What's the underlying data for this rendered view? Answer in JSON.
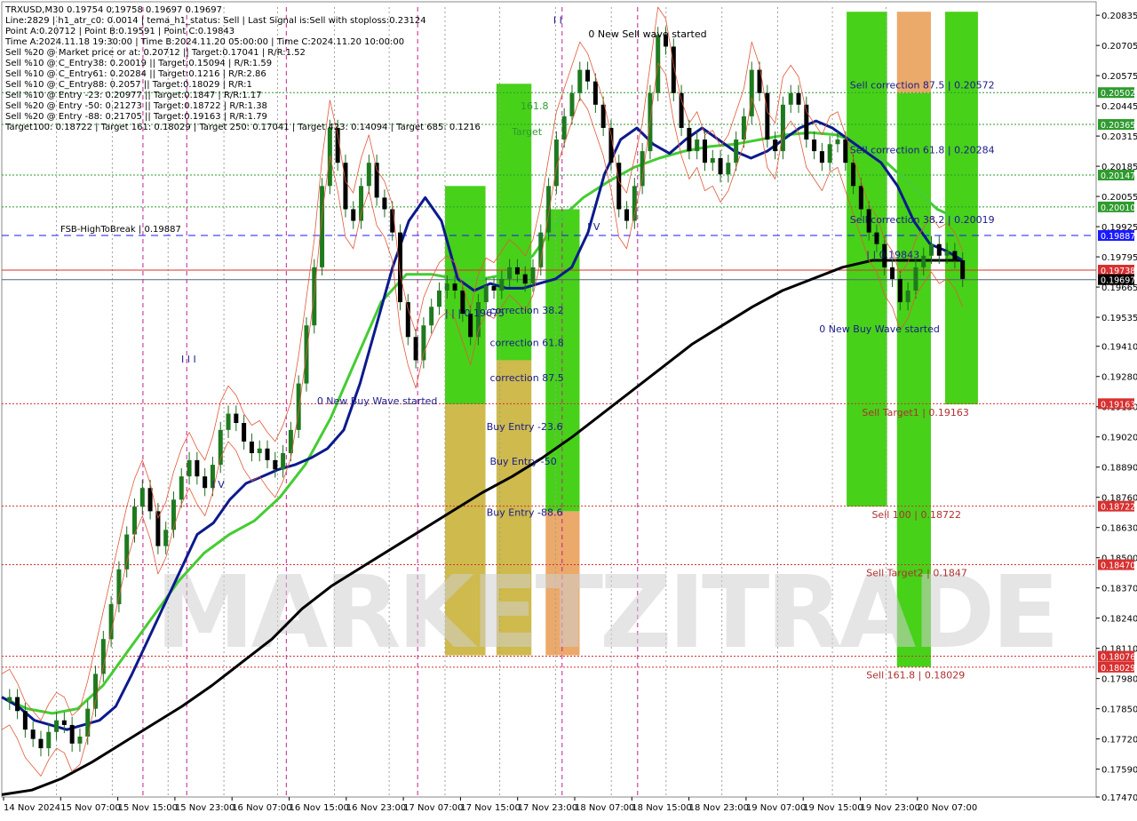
{
  "header": {
    "symbol_line": "TRXUSD,M30  0.19754 0.19758 0.19697 0.19697",
    "lines": [
      "Line:2829  |  h1_atr_c0: 0.0014  |  tema_h1_status: Sell  |  Last Signal is:Sell with stoploss:0.23124",
      "Point A:0.20712  |  Point B:0.19591  |  Point C:0.19843",
      "Time A:2024.11.18 19:30:00  |  Time B:2024.11.20 05:00:00  |  Time C:2024.11.20 10:00:00",
      "Sell %20 @ Market price or at: 0.20712  ||  Target:0.17041  |  R/R:1.52",
      "Sell %10 @ C_Entry38: 0.20019  ||  Target:0.15094  |  R/R:1.59",
      "Sell %10 @ C_Entry61: 0.20284  ||  Target:0.1216  |  R/R:2.86",
      "Sell %10 @ C_Entry88: 0.2057  ||  Target:0.18029  |  R/R:1",
      "Sell %10 @ Entry -23: 0.20977  ||  Target:0.1847  |  R/R:1.17",
      "Sell %20 @ Entry -50: 0.21273  ||  Target:0.18722  |  R/R:1.38",
      "Sell %20 @ Entry -88: 0.21705  ||  Target:0.19163  |  R/R:1.79",
      "Target100: 0.18722  |  Target 161: 0.18029  |  Target 250: 0.17041  |  Target 423: 0.14094  |  Target 685: 0.1216"
    ]
  },
  "watermark": "MARKETZITRADE",
  "colors": {
    "price_tag_green": "#2e9b2e",
    "price_tag_red": "#d83030",
    "price_tag_blue": "#1a1aff",
    "price_tag_black": "#000000",
    "zone_green": "#33cc00",
    "zone_orange": "#e9a05a",
    "zone_olive": "#c9b23a",
    "ma_blue": "#0b1a8c",
    "ma_green": "#44cc33",
    "ma_black": "#000000"
  },
  "chart_data": {
    "type": "line",
    "title": "TRXUSD,M30",
    "ylim": [
      0.1747,
      0.2087
    ],
    "y_ticks": [
      "0.20835",
      "0.20705",
      "0.20575",
      "0.20445",
      "0.20315",
      "0.20185",
      "0.20055",
      "0.19925",
      "0.19795",
      "0.19665",
      "0.19535",
      "0.19410",
      "0.19280",
      "0.19150",
      "0.19020",
      "0.18890",
      "0.18760",
      "0.18630",
      "0.18500",
      "0.18370",
      "0.18240",
      "0.18110",
      "0.17980",
      "0.17850",
      "0.17720",
      "0.17590",
      "0.17470"
    ],
    "x_ticks": [
      "14 Nov 2024",
      "15 Nov 07:00",
      "15 Nov 15:00",
      "15 Nov 23:00",
      "16 Nov 07:00",
      "16 Nov 15:00",
      "16 Nov 23:00",
      "17 Nov 07:00",
      "17 Nov 15:00",
      "17 Nov 23:00",
      "18 Nov 07:00",
      "18 Nov 15:00",
      "18 Nov 23:00",
      "19 Nov 07:00",
      "19 Nov 15:00",
      "19 Nov 23:00",
      "20 Nov 07:00"
    ],
    "close_path": [
      0.1788,
      0.179,
      0.1784,
      0.1776,
      0.1772,
      0.1768,
      0.1775,
      0.178,
      0.1778,
      0.177,
      0.1773,
      0.1785,
      0.18,
      0.1815,
      0.183,
      0.1845,
      0.186,
      0.1872,
      0.188,
      0.187,
      0.1855,
      0.1862,
      0.1875,
      0.1885,
      0.1892,
      0.1885,
      0.188,
      0.189,
      0.1905,
      0.1912,
      0.1908,
      0.19,
      0.1895,
      0.1897,
      0.1892,
      0.1888,
      0.1895,
      0.1905,
      0.1925,
      0.195,
      0.1975,
      0.201,
      0.2035,
      0.202,
      0.2,
      0.1995,
      0.201,
      0.202,
      0.2005,
      0.2,
      0.199,
      0.196,
      0.1945,
      0.1935,
      0.195,
      0.1958,
      0.1965,
      0.1968,
      0.1965,
      0.1955,
      0.1945,
      0.196,
      0.1967,
      0.1965,
      0.197,
      0.1975,
      0.1972,
      0.1968,
      0.1975,
      0.199,
      0.201,
      0.203,
      0.204,
      0.205,
      0.206,
      0.2055,
      0.2045,
      0.2035,
      0.202,
      0.2,
      0.1995,
      0.201,
      0.2025,
      0.205,
      0.2075,
      0.207,
      0.205,
      0.2035,
      0.2025,
      0.203,
      0.202,
      0.2022,
      0.2015,
      0.202,
      0.203,
      0.204,
      0.206,
      0.205,
      0.203,
      0.2025,
      0.2045,
      0.205,
      0.2045,
      0.203,
      0.2025,
      0.202,
      0.2028,
      0.203,
      0.202,
      0.201,
      0.2,
      0.199,
      0.1985,
      0.1975,
      0.197,
      0.196,
      0.1965,
      0.1975,
      0.198,
      0.1985,
      0.198,
      0.1982,
      0.1978,
      0.197
    ],
    "ma_blue_path": [
      0.179,
      0.1786,
      0.178,
      0.1778,
      0.1776,
      0.1778,
      0.178,
      0.1786,
      0.18,
      0.1815,
      0.183,
      0.1845,
      0.186,
      0.1865,
      0.1875,
      0.1882,
      0.1885,
      0.1888,
      0.189,
      0.1893,
      0.1897,
      0.1905,
      0.1925,
      0.195,
      0.1975,
      0.1995,
      0.2005,
      0.1995,
      0.197,
      0.1965,
      0.1968,
      0.1966,
      0.1966,
      0.1968,
      0.197,
      0.1975,
      0.199,
      0.2015,
      0.203,
      0.2035,
      0.2028,
      0.2024,
      0.203,
      0.2035,
      0.203,
      0.2025,
      0.2022,
      0.2025,
      0.203,
      0.2035,
      0.2038,
      0.2035,
      0.203,
      0.2025,
      0.202,
      0.201,
      0.1995,
      0.1985,
      0.1982,
      0.1978
    ],
    "ma_green_path": [
      0.179,
      0.1785,
      0.1783,
      0.1785,
      0.1795,
      0.181,
      0.1825,
      0.184,
      0.1852,
      0.186,
      0.1866,
      0.1876,
      0.189,
      0.191,
      0.1935,
      0.196,
      0.1972,
      0.1972,
      0.197,
      0.197,
      0.1972,
      0.198,
      0.1995,
      0.2005,
      0.2012,
      0.2018,
      0.2022,
      0.2025,
      0.2027,
      0.2028,
      0.203,
      0.2032,
      0.2033,
      0.2032,
      0.2028,
      0.202,
      0.201,
      0.2,
      0.1995
    ],
    "ma_black_path": [
      0.1748,
      0.175,
      0.1755,
      0.1762,
      0.177,
      0.1778,
      0.1786,
      0.1795,
      0.1805,
      0.1815,
      0.1828,
      0.1838,
      0.1846,
      0.1854,
      0.1862,
      0.187,
      0.1878,
      0.1885,
      0.1893,
      0.1902,
      0.1912,
      0.1922,
      0.1932,
      0.1942,
      0.195,
      0.1958,
      0.1965,
      0.197,
      0.1975,
      0.1978,
      0.1978,
      0.1978,
      0.1978
    ],
    "h_lines": [
      {
        "label": "FSB-HighToBreak | 0.19887",
        "value": 0.19887,
        "color": "#1a1aff",
        "style": "dash"
      },
      {
        "label": "",
        "value": 0.19738,
        "color": "#d83030",
        "style": "solid"
      },
      {
        "label": "",
        "value": 0.19697,
        "color": "#556677",
        "style": "solid"
      },
      {
        "label": "",
        "value": 0.20502,
        "color": "#2e9b2e",
        "style": "dot"
      },
      {
        "label": "",
        "value": 0.20365,
        "color": "#2e9b2e",
        "style": "dot"
      },
      {
        "label": "",
        "value": 0.20147,
        "color": "#2e9b2e",
        "style": "dot"
      },
      {
        "label": "",
        "value": 0.2001,
        "color": "#2e9b2e",
        "style": "dot"
      },
      {
        "label": "",
        "value": 0.19163,
        "color": "#d83030",
        "style": "dot"
      },
      {
        "label": "",
        "value": 0.18722,
        "color": "#d83030",
        "style": "dot"
      },
      {
        "label": "",
        "value": 0.1847,
        "color": "#d83030",
        "style": "dot"
      },
      {
        "label": "",
        "value": 0.18076,
        "color": "#d83030",
        "style": "dot"
      },
      {
        "label": "",
        "value": 0.18029,
        "color": "#d83030",
        "style": "dot"
      }
    ],
    "price_tags": [
      {
        "text": "0.20502",
        "value": 0.20502,
        "kind": "green"
      },
      {
        "text": "0.20365",
        "value": 0.20365,
        "kind": "green"
      },
      {
        "text": "0.20147",
        "value": 0.20147,
        "kind": "green"
      },
      {
        "text": "0.20010",
        "value": 0.2001,
        "kind": "green"
      },
      {
        "text": "0.19887",
        "value": 0.19887,
        "kind": "blue"
      },
      {
        "text": "0.19738",
        "value": 0.19738,
        "kind": "red"
      },
      {
        "text": "0.19697",
        "value": 0.19697,
        "kind": "black"
      },
      {
        "text": "0.19163",
        "value": 0.19163,
        "kind": "red"
      },
      {
        "text": "0.18722",
        "value": 0.18722,
        "kind": "red"
      },
      {
        "text": "0.18470",
        "value": 0.1847,
        "kind": "red"
      },
      {
        "text": "0.18076",
        "value": 0.18076,
        "kind": "red"
      },
      {
        "text": "0.18029",
        "value": 0.18029,
        "kind": "red"
      }
    ],
    "zones": [
      {
        "kind": "green",
        "x_from": 0.405,
        "x_to": 0.442,
        "y_from": 0.201,
        "y_to": 0.1916
      },
      {
        "kind": "olive",
        "x_from": 0.405,
        "x_to": 0.442,
        "y_from": 0.1916,
        "y_to": 0.1808
      },
      {
        "kind": "green",
        "x_from": 0.452,
        "x_to": 0.484,
        "y_from": 0.2054,
        "y_to": 0.1935
      },
      {
        "kind": "olive",
        "x_from": 0.452,
        "x_to": 0.484,
        "y_from": 0.1935,
        "y_to": 0.1808
      },
      {
        "kind": "green",
        "x_from": 0.497,
        "x_to": 0.528,
        "y_from": 0.2,
        "y_to": 0.187
      },
      {
        "kind": "orange",
        "x_from": 0.497,
        "x_to": 0.528,
        "y_from": 0.187,
        "y_to": 0.1808
      },
      {
        "kind": "green",
        "x_from": 0.772,
        "x_to": 0.809,
        "y_from": 0.2085,
        "y_to": 0.1872
      },
      {
        "kind": "orange",
        "x_from": 0.818,
        "x_to": 0.849,
        "y_from": 0.2085,
        "y_to": 0.205
      },
      {
        "kind": "green",
        "x_from": 0.818,
        "x_to": 0.849,
        "y_from": 0.205,
        "y_to": 0.1803
      },
      {
        "kind": "green",
        "x_from": 0.862,
        "x_to": 0.892,
        "y_from": 0.2085,
        "y_to": 0.1916
      }
    ],
    "annotations": [
      {
        "text": "0 New Sell wave started",
        "x": 0.536,
        "value": 0.2074,
        "color": "#000000"
      },
      {
        "text": "Sell correction 87.5 | 0.20572",
        "x": 0.775,
        "value": 0.2052,
        "color": "#1b1b8a"
      },
      {
        "text": "Sell correction 61.8 | 0.20284",
        "x": 0.775,
        "value": 0.2024,
        "color": "#1b1b8a"
      },
      {
        "text": "Sell correction 38.2 | 0.20019",
        "x": 0.775,
        "value": 0.1994,
        "color": "#1b1b8a"
      },
      {
        "text": "0 New Buy Wave started",
        "x": 0.747,
        "value": 0.1947,
        "color": "#1b1b8a"
      },
      {
        "text": "0 New Buy Wave started",
        "x": 0.288,
        "value": 0.1916,
        "color": "#1b1b8a"
      },
      {
        "text": "Sell Target1 | 0.19163",
        "x": 0.786,
        "value": 0.1911,
        "color": "#b03030"
      },
      {
        "text": "Sell 100 | 0.18722",
        "x": 0.795,
        "value": 0.1867,
        "color": "#b03030"
      },
      {
        "text": "Sell Target2 | 0.1847",
        "x": 0.79,
        "value": 0.1842,
        "color": "#b03030"
      },
      {
        "text": "Sell 161.8 | 0.18029",
        "x": 0.79,
        "value": 0.1798,
        "color": "#b03030"
      },
      {
        "text": "correction 38.2",
        "x": 0.446,
        "value": 0.1955,
        "color": "#1b1b8a"
      },
      {
        "text": "correction 61.8",
        "x": 0.446,
        "value": 0.1941,
        "color": "#1b1b8a"
      },
      {
        "text": "correction 87.5",
        "x": 0.446,
        "value": 0.1926,
        "color": "#1b1b8a"
      },
      {
        "text": "Buy Entry -23.6",
        "x": 0.443,
        "value": 0.1905,
        "color": "#1b1b8a"
      },
      {
        "text": "Buy Entry -50",
        "x": 0.446,
        "value": 0.189,
        "color": "#1b1b8a"
      },
      {
        "text": "Buy Entry -88.6",
        "x": 0.443,
        "value": 0.1868,
        "color": "#1b1b8a"
      },
      {
        "text": "| | | 0.19675",
        "x": 0.405,
        "value": 0.1954,
        "color": "#1b1b8a"
      },
      {
        "text": "| | 0.19843",
        "x": 0.79,
        "value": 0.1979,
        "color": "#1b1b8a"
      },
      {
        "text": "I V",
        "x": 0.192,
        "value": 0.188,
        "color": "#1b1b8a"
      },
      {
        "text": "I V",
        "x": 0.535,
        "value": 0.1991,
        "color": "#1b1b8a"
      },
      {
        "text": "I I I",
        "x": 0.164,
        "value": 0.1934,
        "color": "#1b1b8a"
      },
      {
        "text": "I I",
        "x": 0.504,
        "value": 0.208,
        "color": "#1b1b8a"
      },
      {
        "text": "161.8",
        "x": 0.474,
        "value": 0.2043,
        "color": "#2e9b2e"
      },
      {
        "text": "Target",
        "x": 0.466,
        "value": 0.2032,
        "color": "#2e9b2e"
      }
    ],
    "vlines_magenta": [
      0.129,
      0.169,
      0.26,
      0.38,
      0.512,
      0.581
    ],
    "vlines_gray": [
      0.05,
      0.101,
      0.152,
      0.203,
      0.252,
      0.304,
      0.354,
      0.405,
      0.455,
      0.506,
      0.557,
      0.607,
      0.658,
      0.709,
      0.759,
      0.808
    ]
  }
}
